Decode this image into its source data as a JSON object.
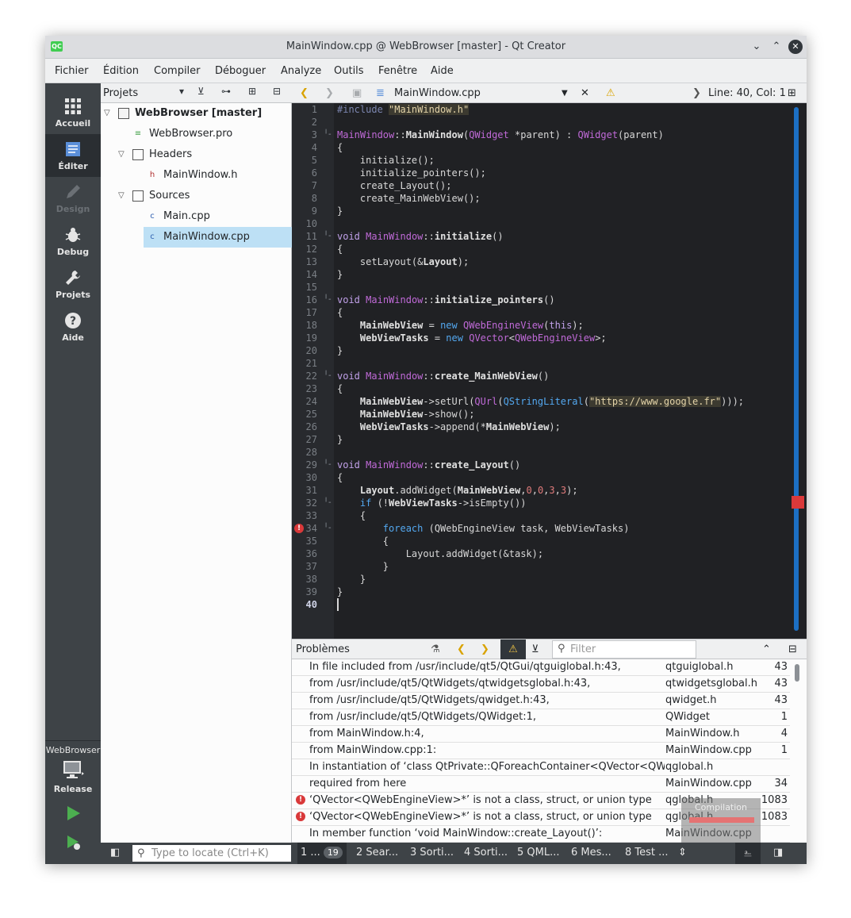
{
  "window": {
    "title": "MainWindow.cpp @ WebBrowser [master] - Qt Creator",
    "app_icon_text": "QC",
    "controls": {
      "minimize": "⌄",
      "maximize": "⌃",
      "close": "✕"
    }
  },
  "menubar": [
    "Fichier",
    "Édition",
    "Compiler",
    "Déboguer",
    "Analyze",
    "Outils",
    "Fenêtre",
    "Aide"
  ],
  "modes": [
    {
      "label": "Accueil",
      "icon": "grid-icon"
    },
    {
      "label": "Éditer",
      "icon": "edit-document-icon"
    },
    {
      "label": "Design",
      "icon": "pencil-icon"
    },
    {
      "label": "Debug",
      "icon": "bug-icon"
    },
    {
      "label": "Projets",
      "icon": "wrench-icon"
    },
    {
      "label": "Aide",
      "icon": "question-icon"
    }
  ],
  "kit": {
    "project": "WebBrowser",
    "config": "Release"
  },
  "projects": {
    "header_label": "Projets",
    "tree": [
      {
        "label": "WebBrowser [master]",
        "bold": true
      },
      {
        "label": "WebBrowser.pro"
      },
      {
        "label": "Headers"
      },
      {
        "label": "MainWindow.h"
      },
      {
        "label": "Sources"
      },
      {
        "label": "Main.cpp"
      },
      {
        "label": "MainWindow.cpp",
        "selected": true
      }
    ]
  },
  "editor": {
    "file": "MainWindow.cpp",
    "position": "Line: 40, Col: 1",
    "current_line": 40,
    "error_line": 34,
    "line_count": 40
  },
  "problems": {
    "title": "Problèmes",
    "filter_placeholder": "Filter",
    "rows": [
      {
        "desc": "In file included from /usr/include/qt5/QtGui/qtguiglobal.h:43,",
        "file": "qtguiglobal.h",
        "line": "43",
        "error": false
      },
      {
        "desc": "from /usr/include/qt5/QtWidgets/qtwidgetsglobal.h:43,",
        "file": "qtwidgetsglobal.h",
        "line": "43",
        "error": false
      },
      {
        "desc": "from /usr/include/qt5/QtWidgets/qwidget.h:43,",
        "file": "qwidget.h",
        "line": "43",
        "error": false
      },
      {
        "desc": "from /usr/include/qt5/QtWidgets/QWidget:1,",
        "file": "QWidget",
        "line": "1",
        "error": false
      },
      {
        "desc": "from MainWindow.h:4,",
        "file": "MainWindow.h",
        "line": "4",
        "error": false
      },
      {
        "desc": "from MainWindow.cpp:1:",
        "file": "MainWindow.cpp",
        "line": "1",
        "error": false
      },
      {
        "desc": "In instantiation of ‘class QtPrivate::QForeachContainer<QVector<QWebEn",
        "file": "qglobal.h",
        "line": "",
        "error": false
      },
      {
        "desc": "required from here",
        "file": "MainWindow.cpp",
        "line": "34",
        "error": false
      },
      {
        "desc": "‘QVector<QWebEngineView>*’ is not a class, struct, or union type",
        "file": "qglobal.h",
        "line": "1083",
        "error": true
      },
      {
        "desc": "‘QVector<QWebEngineView>*’ is not a class, struct, or union type",
        "file": "qglobal.h",
        "line": "1083",
        "error": true
      },
      {
        "desc": "In member function ‘void MainWindow::create_Layout()’:",
        "file": "MainWindow.cpp",
        "line": "",
        "error": false
      }
    ],
    "toast": "Compilation"
  },
  "statusbar": {
    "locate_placeholder": "Type to locate (Ctrl+K)",
    "tabs": [
      {
        "label": "1 ...",
        "badge": "19"
      },
      {
        "label": "2 Sear..."
      },
      {
        "label": "3 Sorti..."
      },
      {
        "label": "4 Sorti..."
      },
      {
        "label": "5 QML..."
      },
      {
        "label": "6 Mes..."
      },
      {
        "label": "8 Test ..."
      }
    ]
  }
}
